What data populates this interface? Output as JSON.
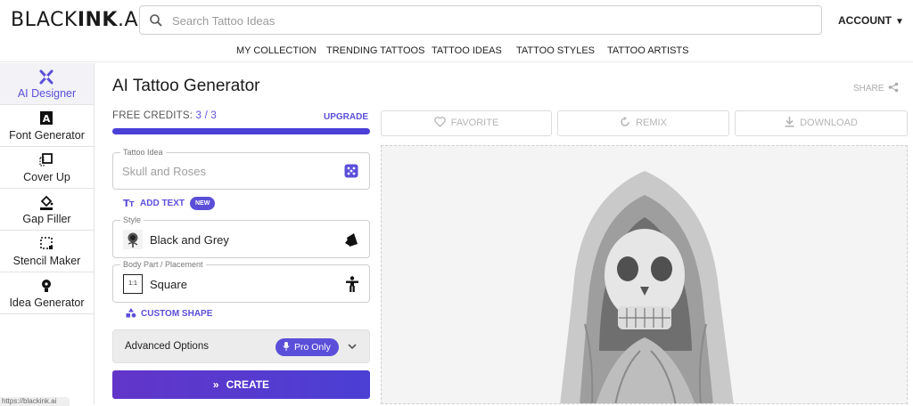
{
  "brand": {
    "logo_thin": "BLACK",
    "logo_bold": "INK",
    "logo_suffix": ".AI"
  },
  "search": {
    "placeholder": "Search Tattoo Ideas",
    "icon": "search-icon"
  },
  "account": {
    "label": "ACCOUNT"
  },
  "nav": {
    "items": [
      "MY COLLECTION",
      "TRENDING TATTOOS",
      "TATTOO IDEAS",
      "TATTOO STYLES",
      "TATTOO ARTISTS"
    ]
  },
  "sidebar": {
    "items": [
      {
        "label": "AI Designer",
        "icon": "ai-designer-icon",
        "active": true
      },
      {
        "label": "Font Generator",
        "icon": "font-generator-icon"
      },
      {
        "label": "Cover Up",
        "icon": "cover-up-icon"
      },
      {
        "label": "Gap Filler",
        "icon": "gap-filler-icon"
      },
      {
        "label": "Stencil Maker",
        "icon": "stencil-maker-icon"
      },
      {
        "label": "Idea Generator",
        "icon": "idea-generator-icon"
      }
    ],
    "status_url": "https://blackink.ai"
  },
  "main": {
    "title": "AI Tattoo Generator",
    "share_label": "SHARE",
    "credits": {
      "label": "FREE CREDITS:",
      "used": "3",
      "separator": "/",
      "total": "3",
      "upgrade": "UPGRADE",
      "fill_fraction": 1.0
    },
    "tattoo_idea": {
      "legend": "Tattoo Idea",
      "placeholder": "Skull and Roses"
    },
    "add_text": {
      "label": "ADD TEXT",
      "badge": "NEW"
    },
    "style": {
      "legend": "Style",
      "value": "Black and Grey"
    },
    "placement": {
      "legend": "Body Part / Placement",
      "value": "Square",
      "thumb": "1:1"
    },
    "custom_shape": {
      "label": "CUSTOM SHAPE"
    },
    "advanced": {
      "label": "Advanced Options",
      "pro_label": "Pro Only"
    },
    "create_label": "CREATE",
    "actions": {
      "favorite": "FAVORITE",
      "remix": "REMIX",
      "download": "DOWNLOAD"
    }
  },
  "colors": {
    "accent": "#5b4fd9",
    "create_start": "#6235c9",
    "create_end": "#4b3fd4"
  }
}
